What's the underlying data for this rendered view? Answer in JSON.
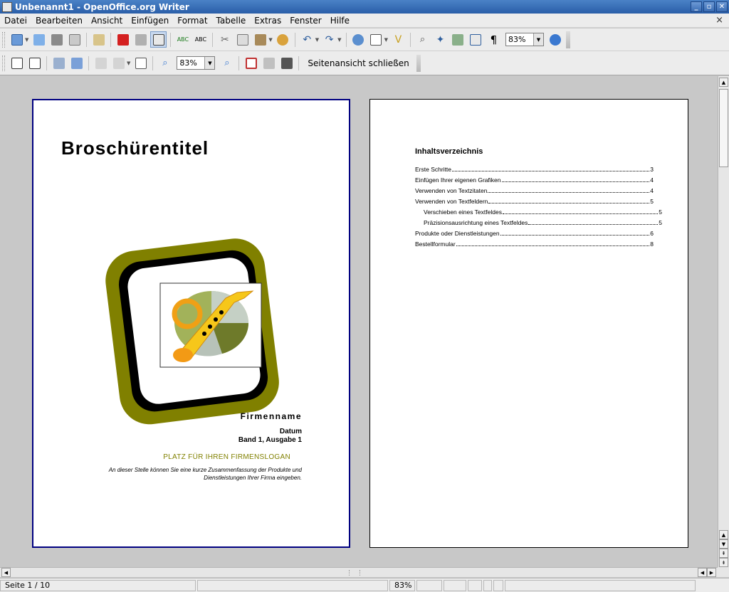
{
  "window": {
    "title": "Unbenannt1 - OpenOffice.org Writer",
    "buttons": [
      "minimize-icon",
      "restore-icon",
      "close-icon"
    ]
  },
  "menu": {
    "items": [
      "Datei",
      "Bearbeiten",
      "Ansicht",
      "Einfügen",
      "Format",
      "Tabelle",
      "Extras",
      "Fenster",
      "Hilfe"
    ],
    "close_doc": "×"
  },
  "toolbar_standard": {
    "zoom_value": "83%",
    "spell_label_1": "ABC",
    "spell_label_2": "ABC"
  },
  "toolbar_preview": {
    "zoom_value": "83%",
    "close_preview_label": "Seitenansicht schließen"
  },
  "page1": {
    "title": "Broschürentitel",
    "company": "Firmenname",
    "date": "Datum",
    "issue": "Band 1, Ausgabe 1",
    "slogan": "PLATZ FÜR IHREN FIRMENSLOGAN",
    "summary_line1": "An dieser Stelle können Sie eine kurze Zusammenfassung der Produkte und",
    "summary_line2": "Dienstleistungen Ihrer Firma eingeben.",
    "colors": {
      "frame_olive": "#808000",
      "slogan": "#808000",
      "page_border": "#000080"
    }
  },
  "page2": {
    "toc_title": "Inhaltsverzeichnis",
    "toc": [
      {
        "text": "Erste Schritte",
        "page": "3",
        "indent": false
      },
      {
        "text": "Einfügen Ihrer eigenen Grafiken",
        "page": "4",
        "indent": false
      },
      {
        "text": "Verwenden von Textzitaten",
        "page": "4",
        "indent": false
      },
      {
        "text": "Verwenden von Textfeldern",
        "page": "5",
        "indent": false
      },
      {
        "text": "Verschieben eines Textfeldes",
        "page": "5",
        "indent": true
      },
      {
        "text": "Präzisionsausrichtung eines Textfeldes",
        "page": "5",
        "indent": true
      },
      {
        "text": "Produkte oder Dienstleistungen",
        "page": "6",
        "indent": false
      },
      {
        "text": "Bestellformular",
        "page": "8",
        "indent": false
      }
    ]
  },
  "status": {
    "page": "Seite 1 / 10",
    "zoom": "83%"
  }
}
